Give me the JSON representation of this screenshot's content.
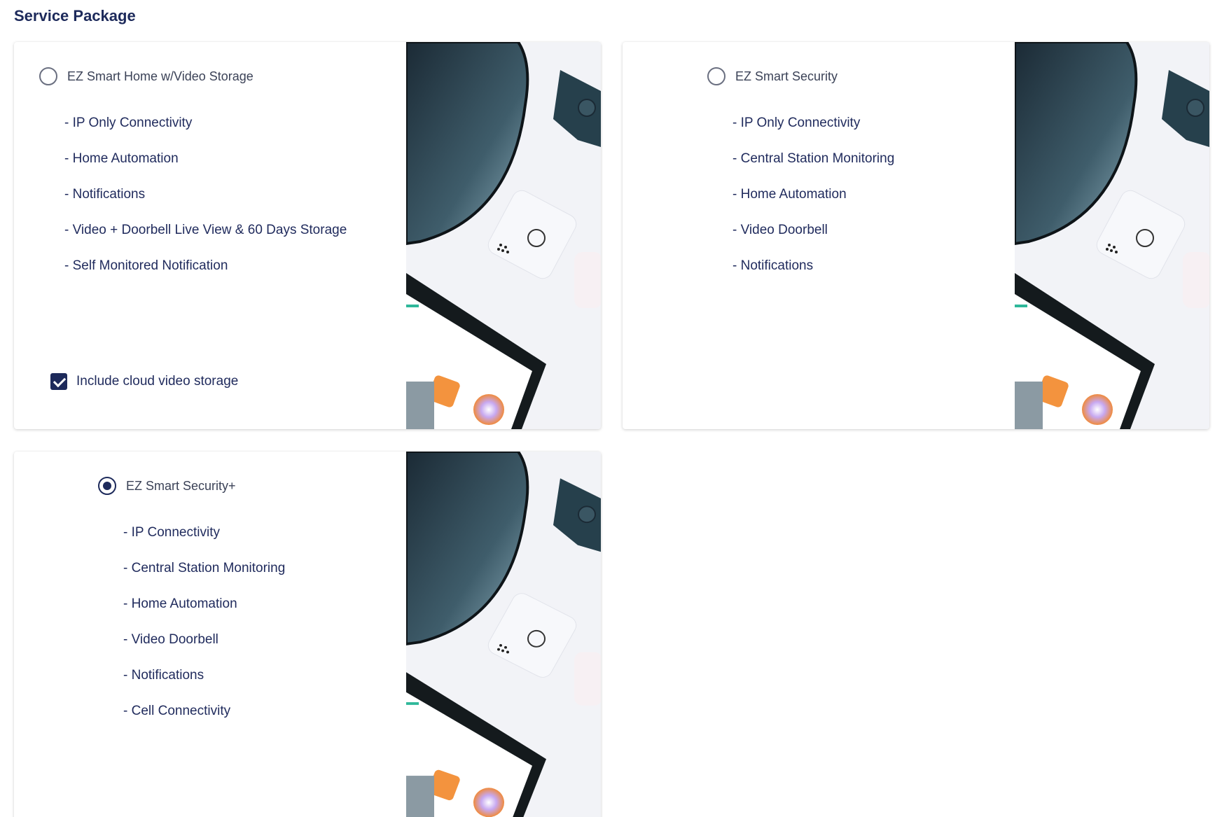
{
  "section_title": "Service Package",
  "packages": [
    {
      "name": "EZ Smart Home w/Video Storage",
      "selected": false,
      "features": [
        "- IP Only Connectivity",
        "- Home Automation",
        "- Notifications",
        "- Video + Doorbell Live View & 60 Days Storage",
        "- Self Monitored Notification"
      ],
      "addon": {
        "label": "Include cloud video storage",
        "checked": true
      }
    },
    {
      "name": "EZ Smart Security",
      "selected": false,
      "features": [
        "- IP Only Connectivity",
        "- Central Station Monitoring",
        "- Home Automation",
        "- Video Doorbell",
        "- Notifications"
      ]
    },
    {
      "name": "EZ Smart Security+",
      "selected": true,
      "features": [
        "- IP Connectivity",
        "- Central Station Monitoring",
        "- Home Automation",
        "- Video Doorbell",
        "- Notifications",
        "- Cell Connectivity"
      ]
    }
  ],
  "colors": {
    "accent": "#1d2a5b",
    "text": "#1f2a5c",
    "radio_border": "#6a6f80"
  }
}
